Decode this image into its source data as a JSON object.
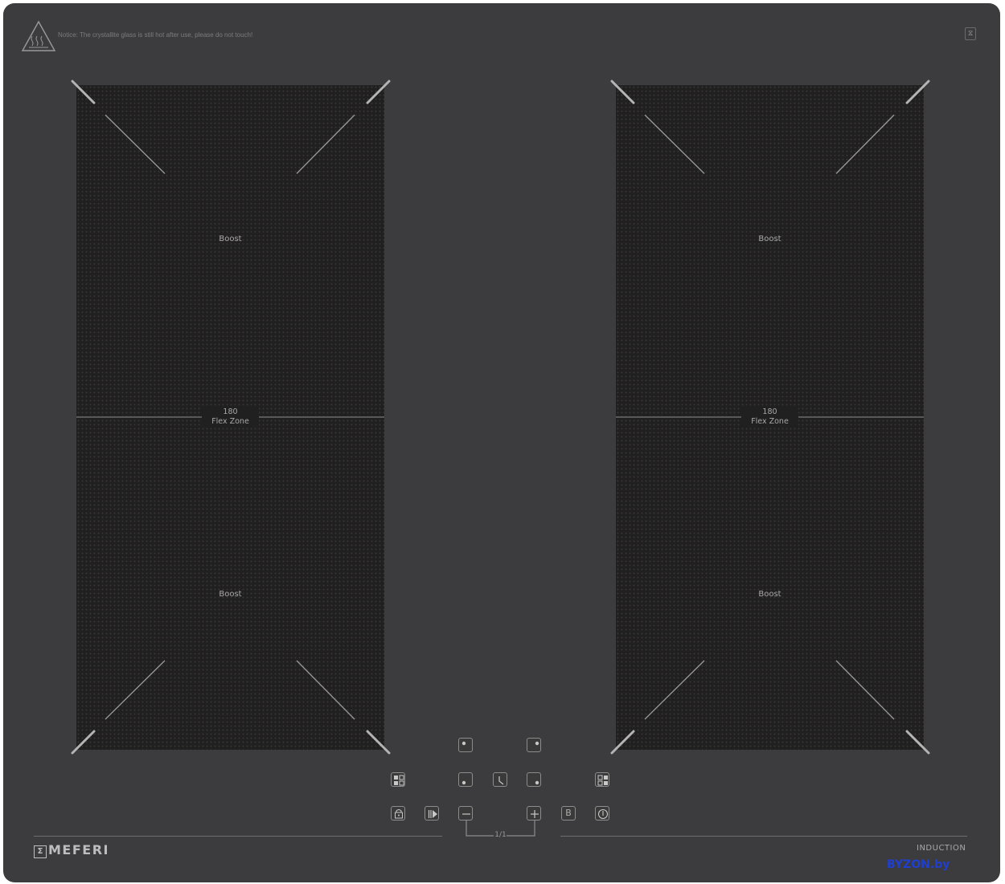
{
  "notice": {
    "text": "Notice: The crystallite glass is still hot after use, please do not touch!",
    "icon": "hot-surface-warning-icon"
  },
  "corner_icon": {
    "icon": "child-lock-icon",
    "glyph": "⧖"
  },
  "zones": {
    "left": {
      "top_label": "Boost",
      "bottom_label": "Boost",
      "flex_number": "180",
      "flex_label": "Flex Zone"
    },
    "right": {
      "top_label": "Boost",
      "bottom_label": "Boost",
      "flex_number": "180",
      "flex_label": "Flex Zone"
    }
  },
  "controls": {
    "zone_front_left": "zone-select-front-left-icon",
    "zone_rear_left": "zone-select-rear-left-icon",
    "zone_front_right": "zone-select-front-right-icon",
    "zone_rear_right": "zone-select-rear-right-icon",
    "timer": "timer-icon",
    "flex_left": "flex-zone-left-icon",
    "flex_right": "flex-zone-right-icon",
    "lock": "lock-icon",
    "pause": "pause-icon",
    "minus": "minus-icon",
    "plus": "plus-icon",
    "boost_label": "B",
    "power": "power-icon",
    "slider_mark": "1/1"
  },
  "brand": {
    "name": "MEFERI",
    "logo_glyph": "Σ"
  },
  "induction_label": "INDUCTION",
  "watermark": "BYZON.by",
  "colors": {
    "glass": "#3c3c3e",
    "zone": "#202020",
    "marking": "#a8a8a8",
    "watermark": "#1f3fd0"
  }
}
